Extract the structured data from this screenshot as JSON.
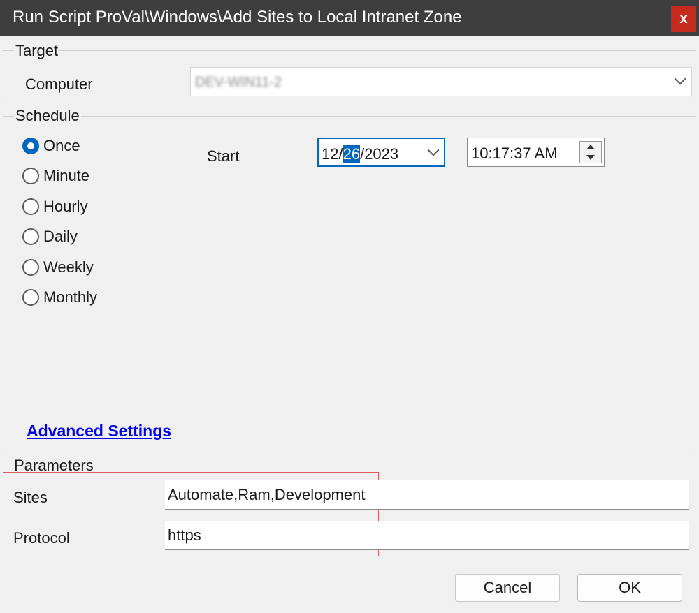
{
  "window": {
    "title": "Run Script ProVal\\Windows\\Add Sites to Local Intranet Zone",
    "close_label": "x",
    "close_color": "#c42b1c",
    "titlebar_color": "#3e3e3e"
  },
  "target": {
    "legend": "Target",
    "computer_label": "Computer",
    "computer_value": "DEV-WIN11-2"
  },
  "schedule": {
    "legend": "Schedule",
    "options": [
      {
        "label": "Once",
        "checked": true
      },
      {
        "label": "Minute",
        "checked": false
      },
      {
        "label": "Hourly",
        "checked": false
      },
      {
        "label": "Daily",
        "checked": false
      },
      {
        "label": "Weekly",
        "checked": false
      },
      {
        "label": "Monthly",
        "checked": false
      }
    ],
    "start_label": "Start",
    "date_prefix": "12/",
    "date_selected": "26",
    "date_suffix": "/2023",
    "time_value": "10:17:37 AM",
    "advanced_link": "Advanced Settings",
    "accent_color": "#0067c0"
  },
  "parameters": {
    "legend": "Parameters",
    "sites_label": "Sites",
    "sites_value": "Automate,Ram,Development",
    "protocol_label": "Protocol",
    "protocol_value": "https"
  },
  "footer": {
    "cancel_label": "Cancel",
    "ok_label": "OK"
  }
}
